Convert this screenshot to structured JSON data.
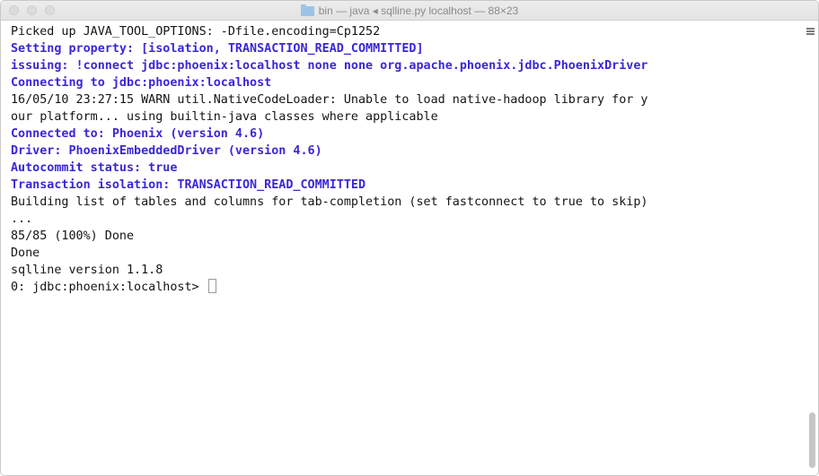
{
  "window": {
    "title": "bin — java ◂ sqlline.py localhost — 88×23"
  },
  "terminal": {
    "lines": [
      {
        "text": "Picked up JAVA_TOOL_OPTIONS: -Dfile.encoding=Cp1252",
        "style": "normal"
      },
      {
        "text": "Setting property: [isolation, TRANSACTION_READ_COMMITTED]",
        "style": "blue"
      },
      {
        "text": "issuing: !connect jdbc:phoenix:localhost none none org.apache.phoenix.jdbc.PhoenixDriver",
        "style": "blue"
      },
      {
        "text": "Connecting to jdbc:phoenix:localhost",
        "style": "blue"
      },
      {
        "text": "16/05/10 23:27:15 WARN util.NativeCodeLoader: Unable to load native-hadoop library for y",
        "style": "normal"
      },
      {
        "text": "our platform... using builtin-java classes where applicable",
        "style": "normal"
      },
      {
        "text": "Connected to: Phoenix (version 4.6)",
        "style": "blue"
      },
      {
        "text": "Driver: PhoenixEmbeddedDriver (version 4.6)",
        "style": "blue"
      },
      {
        "text": "Autocommit status: true",
        "style": "blue"
      },
      {
        "text": "Transaction isolation: TRANSACTION_READ_COMMITTED",
        "style": "blue"
      },
      {
        "text": "Building list of tables and columns for tab-completion (set fastconnect to true to skip)",
        "style": "normal"
      },
      {
        "text": "...",
        "style": "normal"
      },
      {
        "text": "85/85 (100%) Done",
        "style": "normal"
      },
      {
        "text": "Done",
        "style": "normal"
      },
      {
        "text": "sqlline version 1.1.8",
        "style": "normal"
      }
    ],
    "prompt": "0: jdbc:phoenix:localhost>"
  },
  "colors": {
    "info_text": "#3a27d6",
    "normal_text": "#141414",
    "background": "#ffffff"
  }
}
